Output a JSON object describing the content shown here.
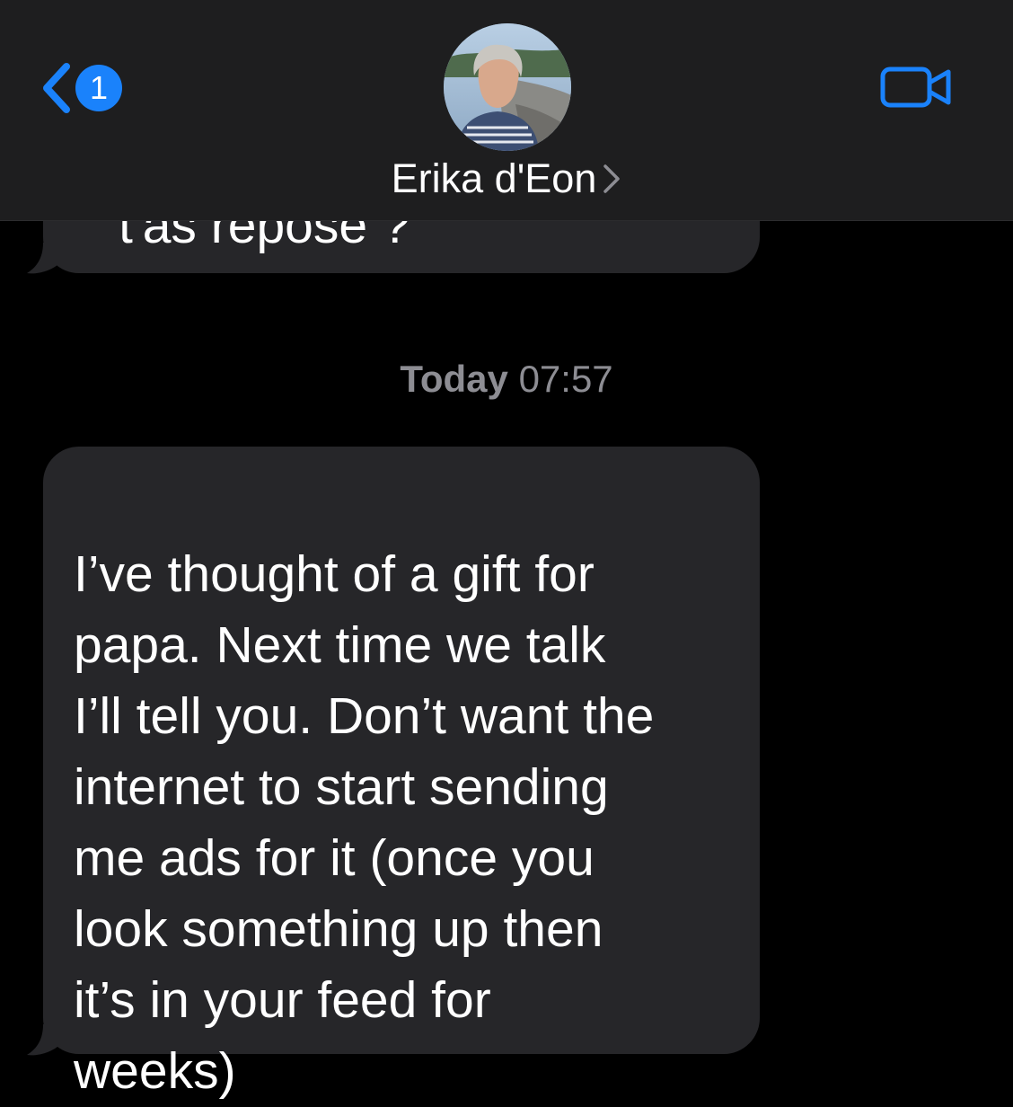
{
  "header": {
    "back_badge_count": "1",
    "contact_name": "Erika d'Eon",
    "accent_color": "#1a82fb",
    "back_icon": "chevron-left-icon",
    "video_icon": "video-camera-icon",
    "chevron_icon": "chevron-right-icon"
  },
  "thread": {
    "previous_message_fragment": "t'as reposé ?",
    "timestamp_day": "Today",
    "timestamp_time": "07:57",
    "message": "I’ve thought of a gift for\npapa. Next time we talk\nI’ll tell you. Don’t want the\ninternet to start sending\nme ads for it (once you\nlook something up then\nit’s in your feed for\nweeks)"
  },
  "colors": {
    "background": "#000000",
    "header_background": "#1e1e1f",
    "incoming_bubble": "#262629",
    "timestamp_text": "#8d8d93"
  }
}
